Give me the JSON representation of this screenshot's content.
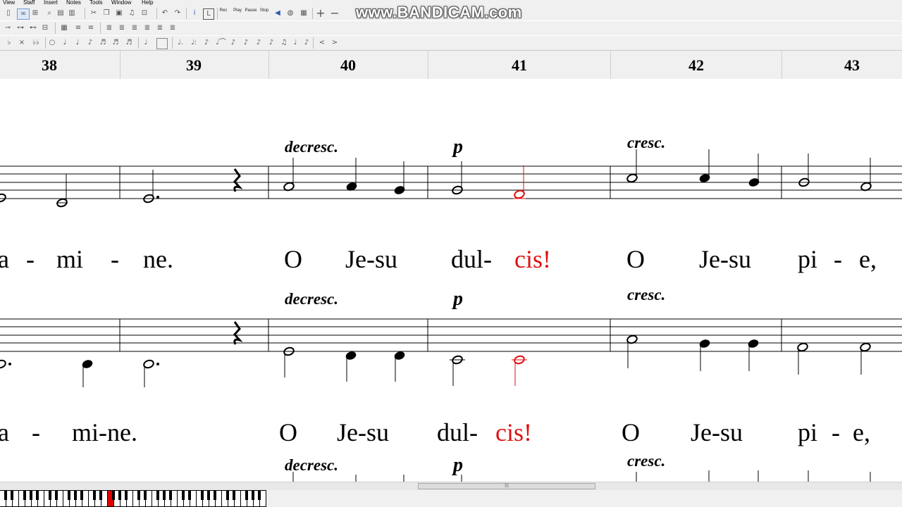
{
  "menu": [
    "View",
    "Staff",
    "Insert",
    "Notes",
    "Tools",
    "Window",
    "Help"
  ],
  "toolbar": {
    "rec_label": "Rec",
    "play_label": "Play",
    "pause_label": "Pause",
    "stop_label": "Stop"
  },
  "watermark": "www.BANDICAM.com",
  "ruler": {
    "measures": [
      "38",
      "39",
      "40",
      "41",
      "42",
      "43"
    ]
  },
  "staves": [
    {
      "dynamics": [
        "decresc.",
        "p",
        "cresc."
      ],
      "lyrics": [
        "a",
        "-",
        "mi",
        "-",
        "ne.",
        "O",
        "Je-su",
        "dul-",
        "cis!",
        "O",
        "Je-su",
        "pi",
        "-",
        "e,"
      ]
    },
    {
      "dynamics": [
        "decresc.",
        "p",
        "cresc."
      ],
      "lyrics": [
        "a",
        "-",
        "mi-ne.",
        "O",
        "Je-su",
        "dul-",
        "cis!",
        "O",
        "Je-su",
        "pi",
        "-",
        "e,"
      ]
    },
    {
      "dynamics": [
        "decresc.",
        "p",
        "cresc."
      ]
    }
  ],
  "colors": {
    "highlight": "#e01010",
    "toolbar_bg": "#f0f0f0"
  },
  "scrollbar_grip": "|||"
}
